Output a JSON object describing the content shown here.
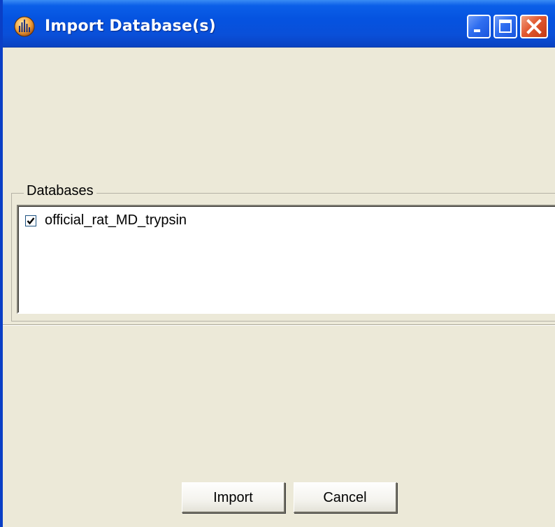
{
  "window": {
    "title": "Import Database(s)",
    "app_icon": "spectrum-app-icon",
    "controls": {
      "minimize_icon": "minimize-icon",
      "maximize_icon": "maximize-icon",
      "close_icon": "close-icon"
    }
  },
  "databases": {
    "legend": "Databases",
    "items": [
      {
        "label": "official_rat_MD_trypsin",
        "checked": true
      }
    ]
  },
  "buttons": {
    "import_label": "Import",
    "cancel_label": "Cancel"
  },
  "colors": {
    "titlebar": "#0553e0",
    "dialog_background": "#ece9d8",
    "close_button": "#e2582f"
  }
}
